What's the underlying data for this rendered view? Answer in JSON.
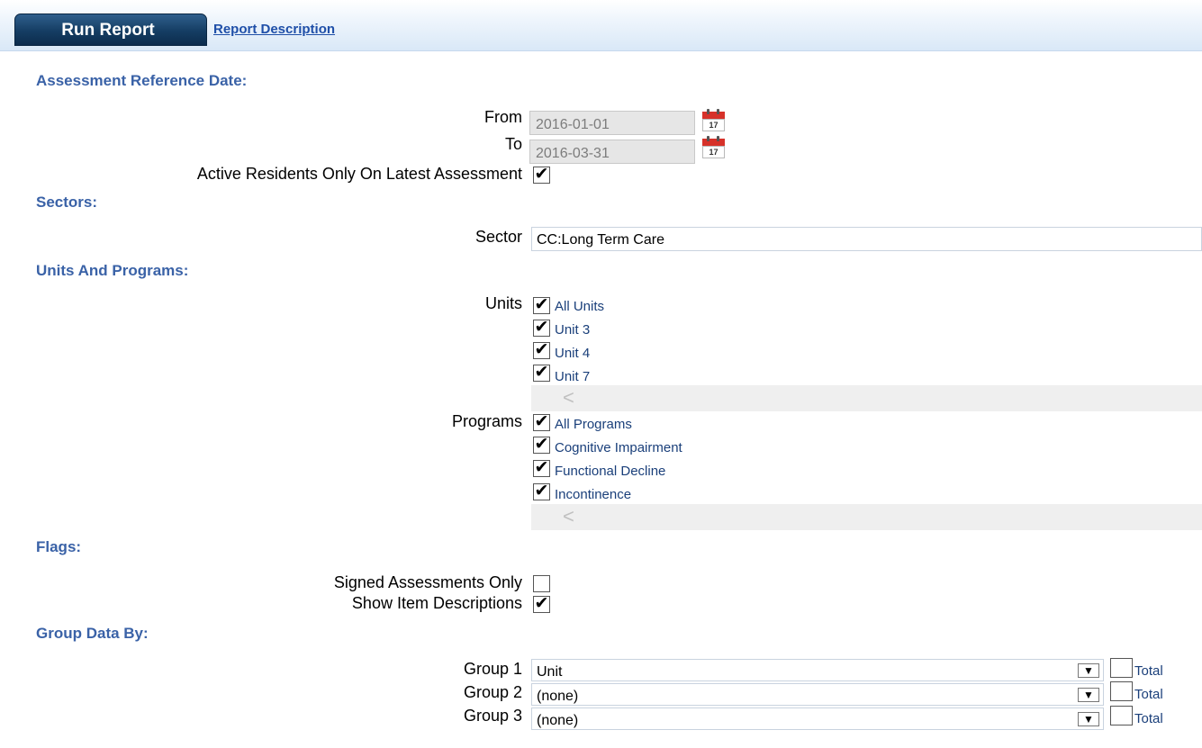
{
  "header": {
    "run_label": "Run Report",
    "description_link": "Report Description"
  },
  "sections": {
    "ard": "Assessment Reference Date:",
    "sectors": "Sectors:",
    "units_programs": "Units And Programs:",
    "flags": "Flags:",
    "group_by": "Group Data By:"
  },
  "dates": {
    "from_label": "From",
    "from_value": "2016-01-01",
    "to_label": "To",
    "to_value": "2016-03-31",
    "calendar_day": "17"
  },
  "active_residents": {
    "label": "Active Residents Only On Latest Assessment",
    "checked": true
  },
  "sector": {
    "label": "Sector",
    "value": "CC:Long Term Care"
  },
  "units": {
    "label": "Units",
    "items": [
      {
        "label": "All Units",
        "checked": true
      },
      {
        "label": "Unit 3",
        "checked": true
      },
      {
        "label": "Unit 4",
        "checked": true
      },
      {
        "label": "Unit 7",
        "checked": true
      }
    ],
    "scroll_arrow": "<"
  },
  "programs": {
    "label": "Programs",
    "items": [
      {
        "label": "All Programs",
        "checked": true
      },
      {
        "label": "Cognitive Impairment",
        "checked": true
      },
      {
        "label": "Functional Decline",
        "checked": true
      },
      {
        "label": "Incontinence",
        "checked": true
      }
    ],
    "scroll_arrow": "<"
  },
  "flags": {
    "signed": {
      "label": "Signed Assessments Only",
      "checked": false
    },
    "descriptions": {
      "label": "Show Item Descriptions",
      "checked": true
    }
  },
  "groups": [
    {
      "label": "Group 1",
      "value": "Unit",
      "total_label": "Total",
      "total_checked": false
    },
    {
      "label": "Group 2",
      "value": "(none)",
      "total_label": "Total",
      "total_checked": false
    },
    {
      "label": "Group 3",
      "value": "(none)",
      "total_label": "Total",
      "total_checked": false
    }
  ],
  "icons": {
    "calendar": "calendar-icon",
    "dropdown": "chevron-down-icon"
  },
  "colors": {
    "section_heading": "#3a62a7",
    "link": "#1f4fa8",
    "run_button": "#153d63"
  }
}
